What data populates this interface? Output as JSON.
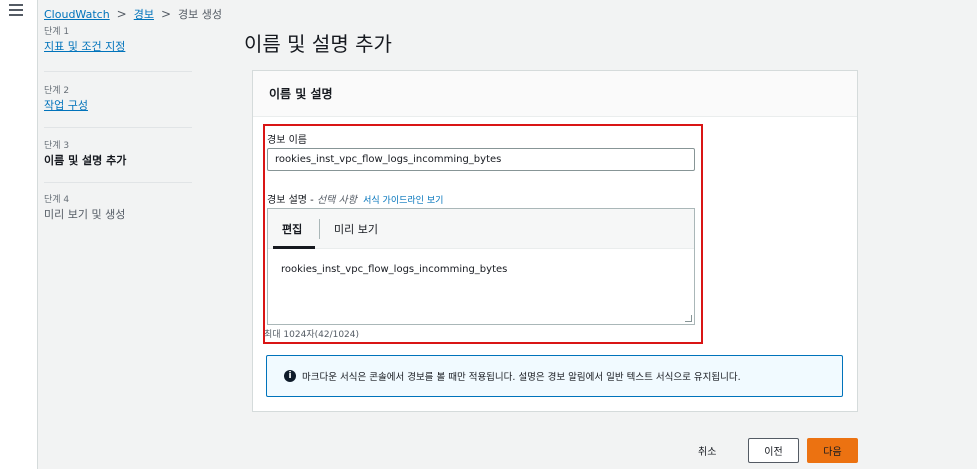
{
  "breadcrumb": {
    "items": [
      "CloudWatch",
      "경보",
      "경보 생성"
    ],
    "separator": ">"
  },
  "steps": [
    {
      "num": "단계 1",
      "label": "지표 및 조건 지정"
    },
    {
      "num": "단계 2",
      "label": "작업 구성"
    },
    {
      "num": "단계 3",
      "label": "이름 및 설명 추가"
    },
    {
      "num": "단계 4",
      "label": "미리 보기 및 생성"
    }
  ],
  "page_title": "이름 및 설명 추가",
  "card": {
    "header": "이름 및 설명",
    "name_label": "경보 이름",
    "name_value": "rookies_inst_vpc_flow_logs_incomming_bytes",
    "desc_label": "경보 설명 -",
    "desc_optional": "선택 사항",
    "desc_guide_link": "서식 가이드라인 보기",
    "tabs": {
      "edit": "편집",
      "preview": "미리 보기"
    },
    "desc_value": "rookies_inst_vpc_flow_logs_incomming_bytes",
    "counter": "최대 1024자(42/1024)",
    "info_icon": "i",
    "info_text": "마크다운 서식은 콘솔에서 경보를 볼 때만 적용됩니다. 설명은 경보 알림에서 일반 텍스트 서식으로 유지됩니다."
  },
  "footer": {
    "cancel": "취소",
    "previous": "이전",
    "next": "다음"
  },
  "colors": {
    "link": "#0073bb",
    "highlight": "#d91515",
    "primary": "#ec7211",
    "info_bg": "#f1faff"
  }
}
